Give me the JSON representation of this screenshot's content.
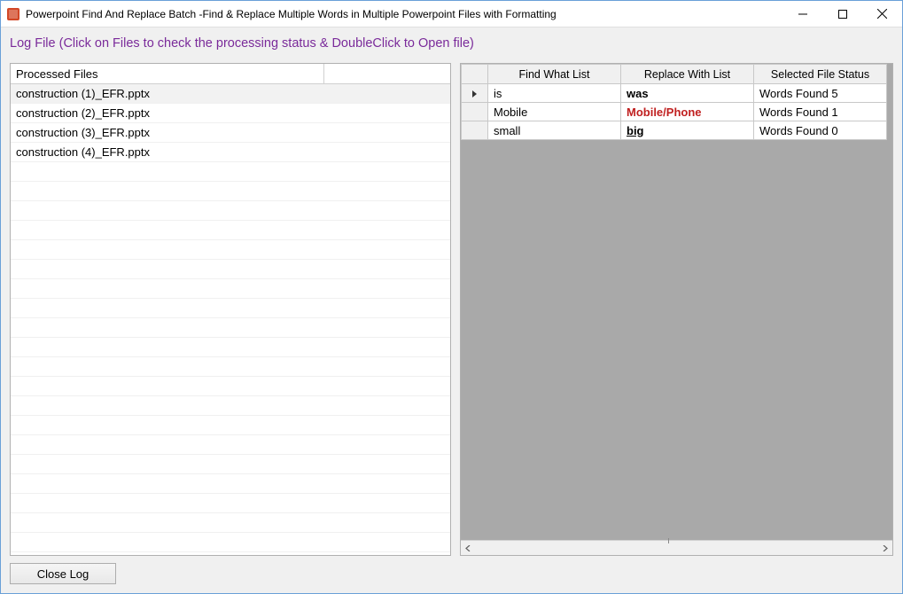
{
  "window": {
    "title": "Powerpoint Find And Replace Batch -Find & Replace Multiple Words in Multiple Powerpoint Files with Formatting"
  },
  "subtitle": "Log File (Click on Files to check the processing status & DoubleClick to Open file)",
  "filesHeader": {
    "col1": "Processed Files"
  },
  "files": [
    {
      "name": "construction (1)_EFR.pptx",
      "selected": true
    },
    {
      "name": "construction (2)_EFR.pptx",
      "selected": false
    },
    {
      "name": "construction (3)_EFR.pptx",
      "selected": false
    },
    {
      "name": "construction (4)_EFR.pptx",
      "selected": false
    }
  ],
  "emptyRowsCount": 21,
  "replaceHeaders": {
    "find": "Find What List",
    "replace": "Replace With List",
    "status": "Selected File Status"
  },
  "replaceRows": [
    {
      "active": true,
      "find": "is",
      "replace": "was",
      "replaceStyle": "bold",
      "status": "Words Found 5"
    },
    {
      "active": false,
      "find": "Mobile",
      "replace": "Mobile/Phone",
      "replaceStyle": "bold red",
      "status": "Words Found 1"
    },
    {
      "active": false,
      "find": "small",
      "replace": "big",
      "replaceStyle": "bold underline",
      "status": "Words Found 0"
    }
  ],
  "footer": {
    "closeLog": "Close Log"
  }
}
